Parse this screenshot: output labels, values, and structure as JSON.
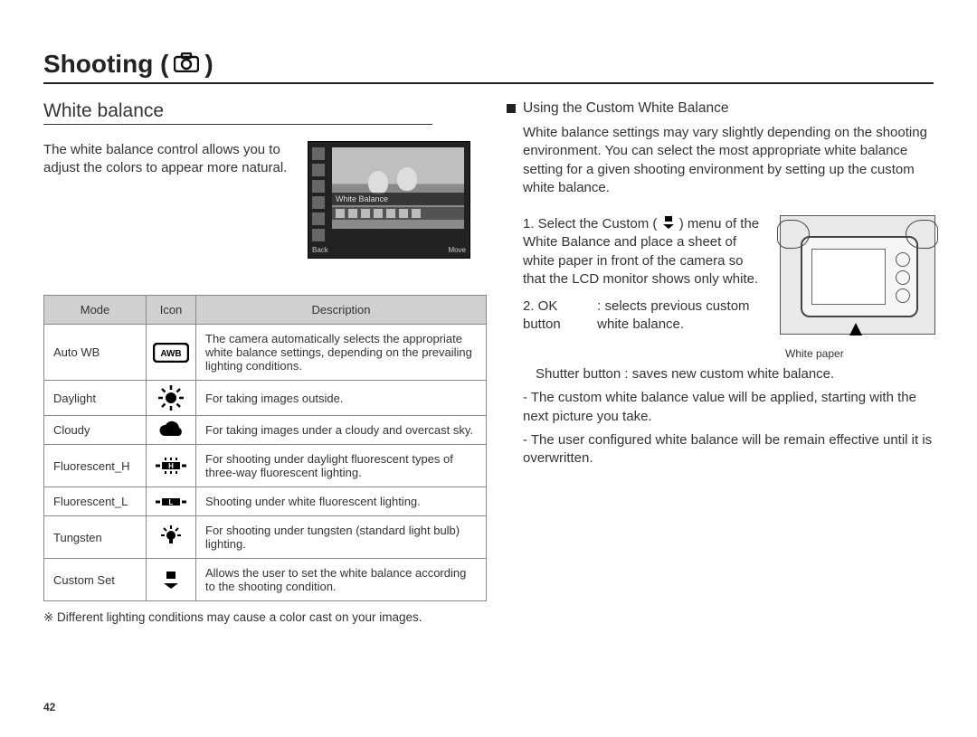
{
  "page_title_prefix": "Shooting (",
  "page_title_suffix": " )",
  "page_number": "42",
  "left": {
    "section": "White balance",
    "intro": "The white balance control allows you to adjust the colors to appear more natural.",
    "lcd": {
      "wb_label": "White Balance",
      "back": "Back",
      "move": "Move"
    },
    "table": {
      "h_mode": "Mode",
      "h_icon": "Icon",
      "h_desc": "Description",
      "rows": [
        {
          "mode": "Auto WB",
          "icon": "awb",
          "desc": "The camera automatically selects the appropriate white balance settings, depending on the prevailing lighting conditions."
        },
        {
          "mode": "Daylight",
          "icon": "sun",
          "desc": "For taking images outside."
        },
        {
          "mode": "Cloudy",
          "icon": "cloud",
          "desc": "For taking images under a cloudy and overcast sky."
        },
        {
          "mode": "Fluorescent_H",
          "icon": "flh",
          "desc": "For shooting under daylight fluorescent types of three-way fluorescent lighting."
        },
        {
          "mode": "Fluorescent_L",
          "icon": "fll",
          "desc": "Shooting under white fluorescent lighting."
        },
        {
          "mode": "Tungsten",
          "icon": "bulb",
          "desc": "For shooting under tungsten (standard light bulb) lighting."
        },
        {
          "mode": "Custom Set",
          "icon": "custom",
          "desc": "Allows the user to set the white balance according to the shooting condition."
        }
      ]
    },
    "note": "※ Different lighting conditions may cause a color cast on your images."
  },
  "right": {
    "subhead": "Using the Custom White Balance",
    "para": "White balance settings may vary slightly depending on the shooting environment. You can select the most appropriate white balance setting for a given shooting environment by setting up the custom white balance.",
    "step1a": "1. Select the Custom (",
    "step1b": ") menu of the White Balance and place a sheet of white paper in front of the camera so that the LCD monitor shows only white.",
    "step2_label": "2. OK button",
    "step2_val": ": selects previous custom white balance.",
    "step3_label": "Shutter button",
    "step3_val": " : saves new custom white balance.",
    "caption": "White paper",
    "bul1": "- The custom white balance value will be applied, starting with the next picture you take.",
    "bul2": "- The user configured white balance will be remain effective until it is overwritten."
  }
}
